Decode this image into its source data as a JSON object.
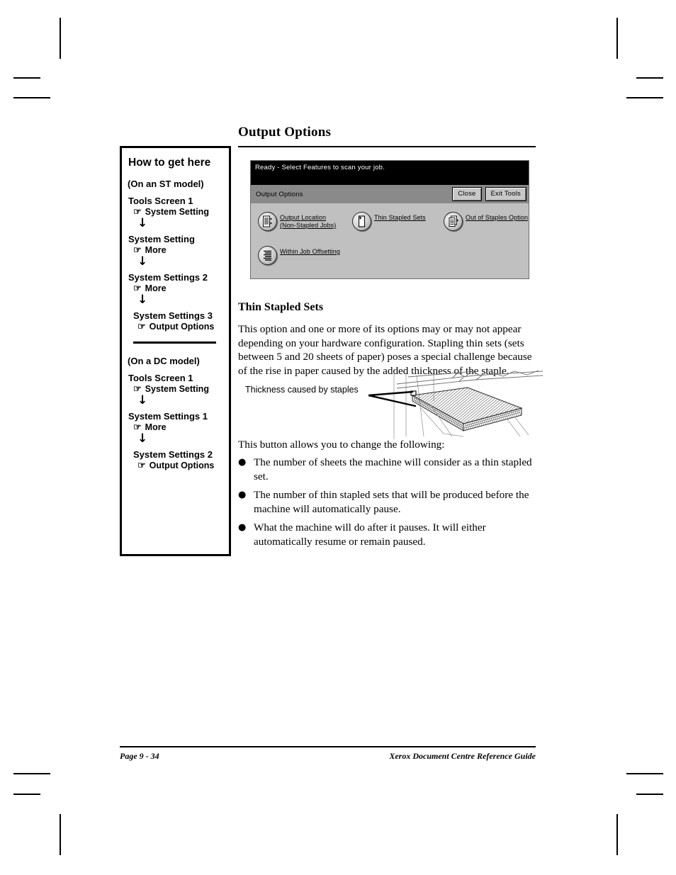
{
  "document": {
    "section_title": "Output Options",
    "subhead": "Thin Stapled Sets",
    "intro_paragraph": "This option and one or more of its options may or may not appear depending on your hardware configuration. Stapling thin sets (sets between 5 and 20 sheets of paper) poses a special challenge because of the rise in paper caused by the added thickness of the staple.",
    "figure_caption": "Thickness caused by staples",
    "lead_in": "This button allows you to change the following:",
    "bullets": [
      "The number of sheets the machine will consider as a thin stapled set.",
      "The number of thin stapled sets that will be produced before the machine will automatically pause.",
      "What the machine will do after it pauses. It will either automatically resume or remain paused."
    ],
    "bullet_glyph": "●"
  },
  "how_to_get_here": {
    "title": "How to get here",
    "hand_glyph": "☞",
    "arrow_glyph": "↓",
    "st_model": {
      "heading": "(On an ST model)",
      "steps": [
        {
          "screen": "Tools Screen 1",
          "action": "System Setting"
        },
        {
          "screen": "System Setting",
          "action": "More"
        },
        {
          "screen": "System Settings 2",
          "action": "More"
        },
        {
          "screen": "System Settings 3",
          "action": "Output Options"
        }
      ]
    },
    "dc_model": {
      "heading": "(On a DC model)",
      "steps": [
        {
          "screen": "Tools Screen 1",
          "action": "System Setting"
        },
        {
          "screen": "System Settings 1",
          "action": "More"
        },
        {
          "screen": "System Settings 2",
          "action": "Output Options"
        }
      ]
    }
  },
  "touchscreen": {
    "status_text": "Ready -  Select Features to scan your job.",
    "panel_title": "Output Options",
    "close_button": "Close",
    "exit_tools_button": "Exit Tools",
    "options": [
      {
        "label_lines": [
          "Output Location ",
          "(Non-Stapled Jobs)"
        ],
        "icon": "document-list-icon"
      },
      {
        "label_lines": [
          "Thin Stapled Sets"
        ],
        "icon": "single-sheet-icon"
      },
      {
        "label_lines": [
          "Out of Staples Option"
        ],
        "icon": "stacked-documents-icon"
      },
      {
        "label_lines": [
          "Within Job Offsetting"
        ],
        "icon": "offset-stack-icon"
      }
    ],
    "colors": {
      "panel_background": "#c0c0c0",
      "title_bar": "#8a8a8a",
      "status_bar": "#000000",
      "button_face": "#c8c8c8"
    }
  },
  "footer": {
    "page_number": "Page 9 - 34",
    "guide_title": "Xerox Document Centre Reference Guide"
  }
}
